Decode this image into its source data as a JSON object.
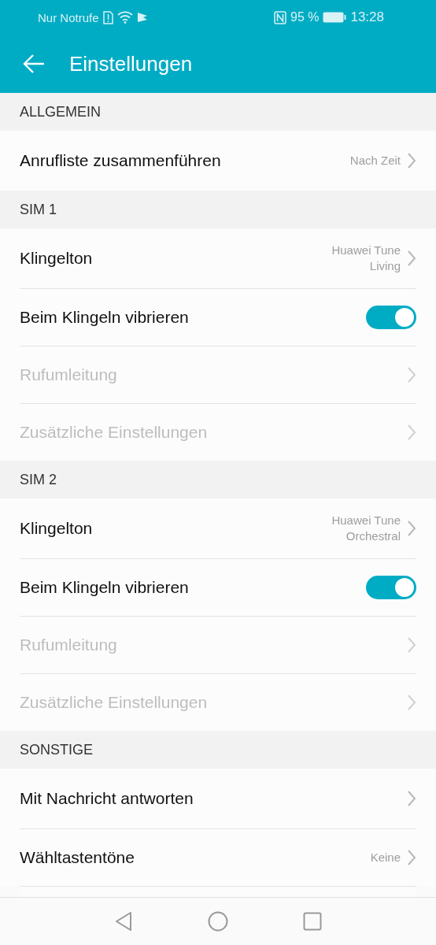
{
  "status_bar": {
    "carrier": "Nur Notrufe",
    "battery": "95 %",
    "time": "13:28"
  },
  "app_bar": {
    "title": "Einstellungen"
  },
  "sections": [
    {
      "title": "ALLGEMEIN",
      "rows": [
        {
          "kind": "link",
          "label": "Anrufliste zusammenführen",
          "value": "Nach Zeit",
          "disabled": false
        }
      ]
    },
    {
      "title": "SIM 1",
      "rows": [
        {
          "kind": "link",
          "label": "Klingelton",
          "value": "Huawei Tune Living",
          "disabled": false
        },
        {
          "kind": "toggle",
          "label": "Beim Klingeln vibrieren",
          "on": true,
          "disabled": false
        },
        {
          "kind": "link",
          "label": "Rufumleitung",
          "disabled": true
        },
        {
          "kind": "link",
          "label": "Zusätzliche Einstellungen",
          "disabled": true
        }
      ]
    },
    {
      "title": "SIM 2",
      "rows": [
        {
          "kind": "link",
          "label": "Klingelton",
          "value": "Huawei Tune Orchestral",
          "disabled": false
        },
        {
          "kind": "toggle",
          "label": "Beim Klingeln vibrieren",
          "on": true,
          "disabled": false
        },
        {
          "kind": "link",
          "label": "Rufumleitung",
          "disabled": true
        },
        {
          "kind": "link",
          "label": "Zusätzliche Einstellungen",
          "disabled": true
        }
      ]
    },
    {
      "title": "SONSTIGE",
      "rows": [
        {
          "kind": "link",
          "label": "Mit Nachricht antworten",
          "disabled": false
        },
        {
          "kind": "link",
          "label": "Wähltastentöne",
          "value": "Keine",
          "disabled": false
        }
      ]
    }
  ]
}
